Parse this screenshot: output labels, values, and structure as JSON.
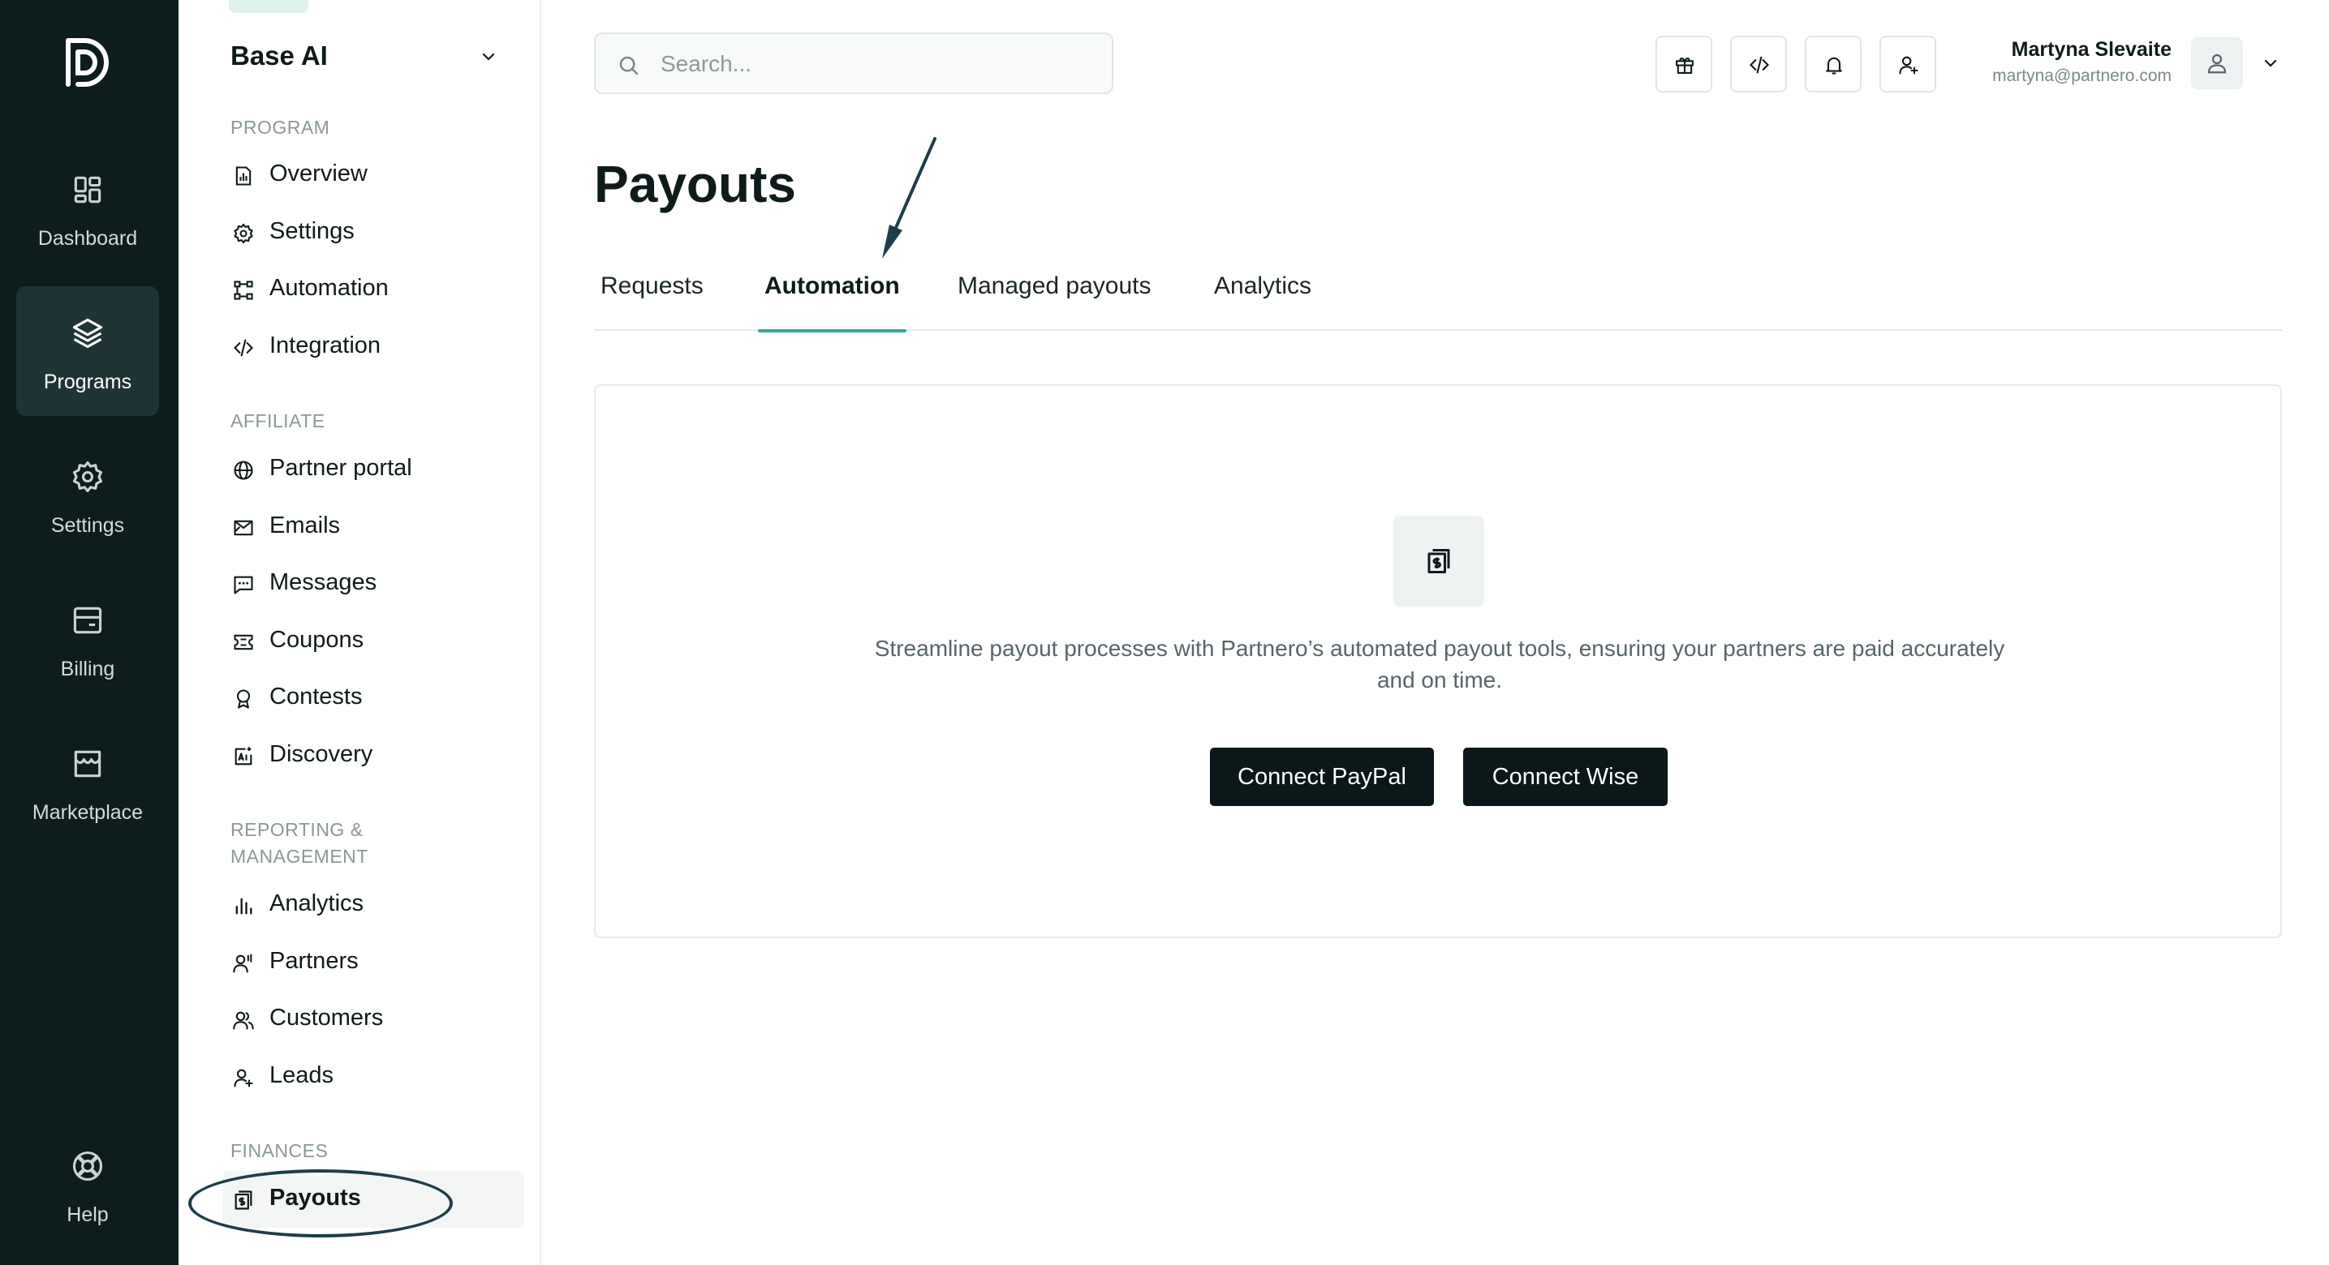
{
  "rail": {
    "items": [
      {
        "label": "Dashboard",
        "icon": "dashboard-icon"
      },
      {
        "label": "Programs",
        "icon": "layers-icon",
        "active": true
      },
      {
        "label": "Settings",
        "icon": "gear-icon"
      },
      {
        "label": "Billing",
        "icon": "billing-icon"
      },
      {
        "label": "Marketplace",
        "icon": "store-icon"
      },
      {
        "label": "Help",
        "icon": "lifebuoy-icon"
      }
    ]
  },
  "sidebar": {
    "program_name": "Base AI",
    "sections": {
      "program": "PROGRAM",
      "affiliate": "AFFILIATE",
      "reporting": "REPORTING & MANAGEMENT",
      "finances": "FINANCES"
    },
    "items": {
      "overview": "Overview",
      "settings": "Settings",
      "automation": "Automation",
      "integration": "Integration",
      "partner_portal": "Partner portal",
      "emails": "Emails",
      "messages": "Messages",
      "coupons": "Coupons",
      "contests": "Contests",
      "discovery": "Discovery",
      "analytics": "Analytics",
      "partners": "Partners",
      "customers": "Customers",
      "leads": "Leads",
      "payouts": "Payouts"
    },
    "active_item": "Payouts"
  },
  "topbar": {
    "search_placeholder": "Search...",
    "buttons": [
      "gift-icon",
      "code-icon",
      "bell-icon",
      "add-user-icon"
    ],
    "user": {
      "name": "Martyna Slevaite",
      "email": "martyna@partnero.com"
    }
  },
  "page": {
    "title": "Payouts",
    "tabs": [
      "Requests",
      "Automation",
      "Managed payouts",
      "Analytics"
    ],
    "active_tab": "Automation"
  },
  "empty_state": {
    "icon": "payouts-icon",
    "description": "Streamline payout processes with Partnero’s automated payout tools, ensuring your partners are paid accurately and on time.",
    "connect_paypal": "Connect PayPal",
    "connect_wise": "Connect Wise"
  },
  "colors": {
    "rail_bg": "#0d1c1d",
    "rail_active": "#1f3435",
    "accent": "#3aa597",
    "button_dark": "#0b1718"
  }
}
